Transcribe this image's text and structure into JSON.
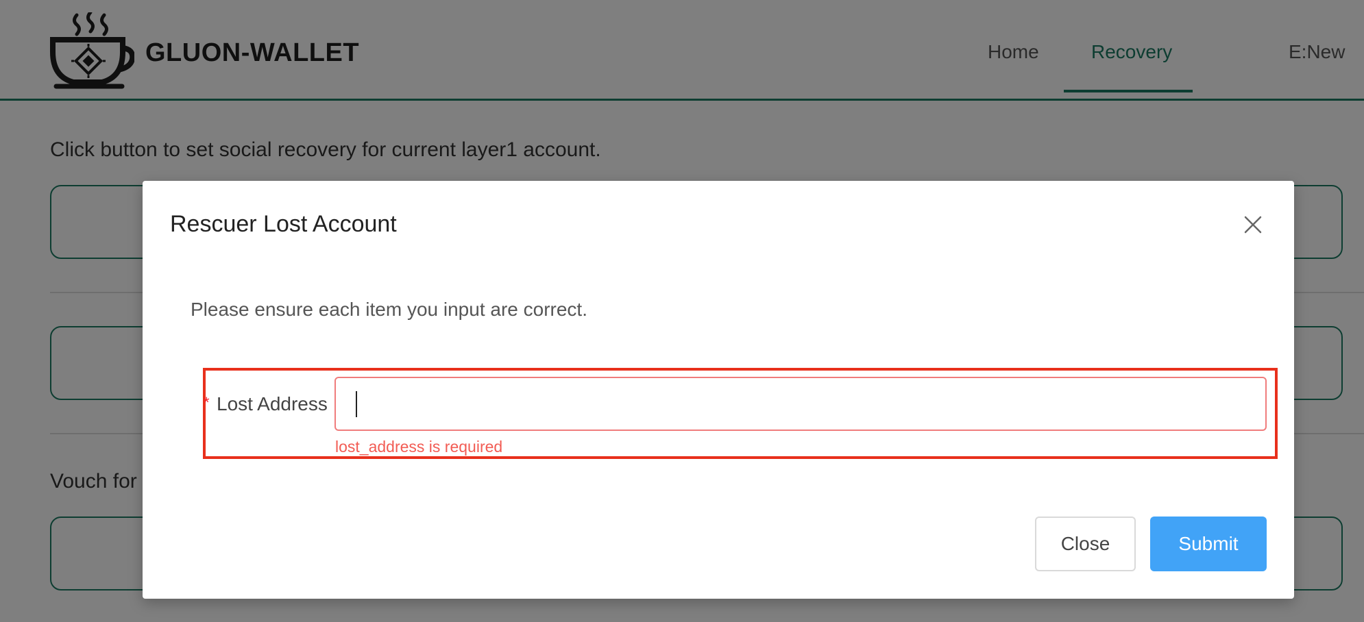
{
  "header": {
    "brand": "GLUON-WALLET",
    "logo_icon": "coffee-cup-chip-icon",
    "nav": [
      {
        "label": "Home",
        "active": false
      },
      {
        "label": "Recovery",
        "active": true
      },
      {
        "label": "E:New",
        "active": false
      }
    ],
    "accent_color": "#1b7a63"
  },
  "background": {
    "intro_text": "Click button to set social recovery for current layer1 account.",
    "vouch_text": "Vouch for t"
  },
  "modal": {
    "title": "Rescuer Lost Account",
    "close_icon": "close-icon",
    "description": "Please ensure each item you input are correct.",
    "field": {
      "required_mark": "*",
      "label": "Lost Address",
      "value": "",
      "error": "lost_address is required"
    },
    "buttons": {
      "close": "Close",
      "submit": "Submit"
    },
    "colors": {
      "error": "#f25c54",
      "highlight": "#e8301c",
      "primary": "#41a3f7"
    }
  }
}
